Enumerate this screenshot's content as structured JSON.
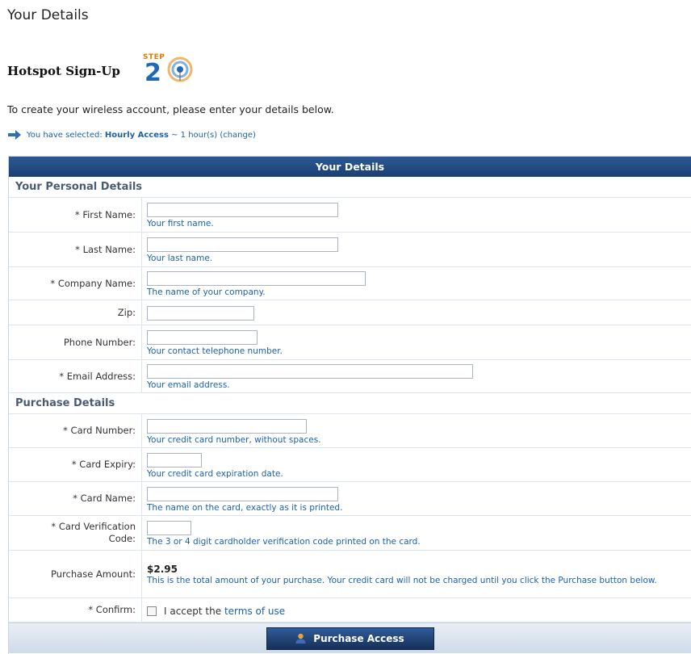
{
  "page": {
    "title": "Your Details",
    "signup_title": "Hotspot Sign-Up",
    "step_label": "STEP",
    "step_number": "2",
    "intro": "To create your wireless account, please enter your details below.",
    "selection": {
      "prefix": "You have selected:",
      "plan": "Hourly Access",
      "duration": "~ 1 hour(s)",
      "change": "(change)"
    }
  },
  "form": {
    "header": "Your Details",
    "personal_section": "Your Personal Details",
    "purchase_section": "Purchase Details",
    "fields": {
      "first_name": {
        "label": "* First Name:",
        "hint": "Your first name.",
        "value": ""
      },
      "last_name": {
        "label": "* Last Name:",
        "hint": "Your last name.",
        "value": ""
      },
      "company": {
        "label": "* Company Name:",
        "hint": "The name of your company.",
        "value": ""
      },
      "zip": {
        "label": "Zip:",
        "value": ""
      },
      "phone": {
        "label": "Phone Number:",
        "hint": "Your contact telephone number.",
        "value": ""
      },
      "email": {
        "label": "* Email Address:",
        "hint": "Your email address.",
        "value": ""
      },
      "card_number": {
        "label": "* Card Number:",
        "hint": "Your credit card number, without spaces.",
        "value": ""
      },
      "card_expiry": {
        "label": "* Card Expiry:",
        "hint": "Your credit card expiration date.",
        "value": ""
      },
      "card_name": {
        "label": "* Card Name:",
        "hint": "The name on the card, exactly as it is printed.",
        "value": ""
      },
      "cvc": {
        "label_line1": "* Card Verification",
        "label_line2": "Code:",
        "hint": "The 3 or 4 digit cardholder verification code printed on the card.",
        "value": ""
      }
    },
    "purchase_amount": {
      "label": "Purchase Amount:",
      "value": "$2.95",
      "note": "This is the total amount of your purchase. Your credit card will not be charged until you click the Purchase button below."
    },
    "confirm": {
      "label": "* Confirm:",
      "text": "I accept the",
      "terms": "terms of use",
      "checked": false
    },
    "submit_label": "Purchase Access"
  },
  "colors": {
    "header_blue": "#1b3f72",
    "link_blue": "#1c62a8",
    "step_orange": "#e67a00"
  }
}
